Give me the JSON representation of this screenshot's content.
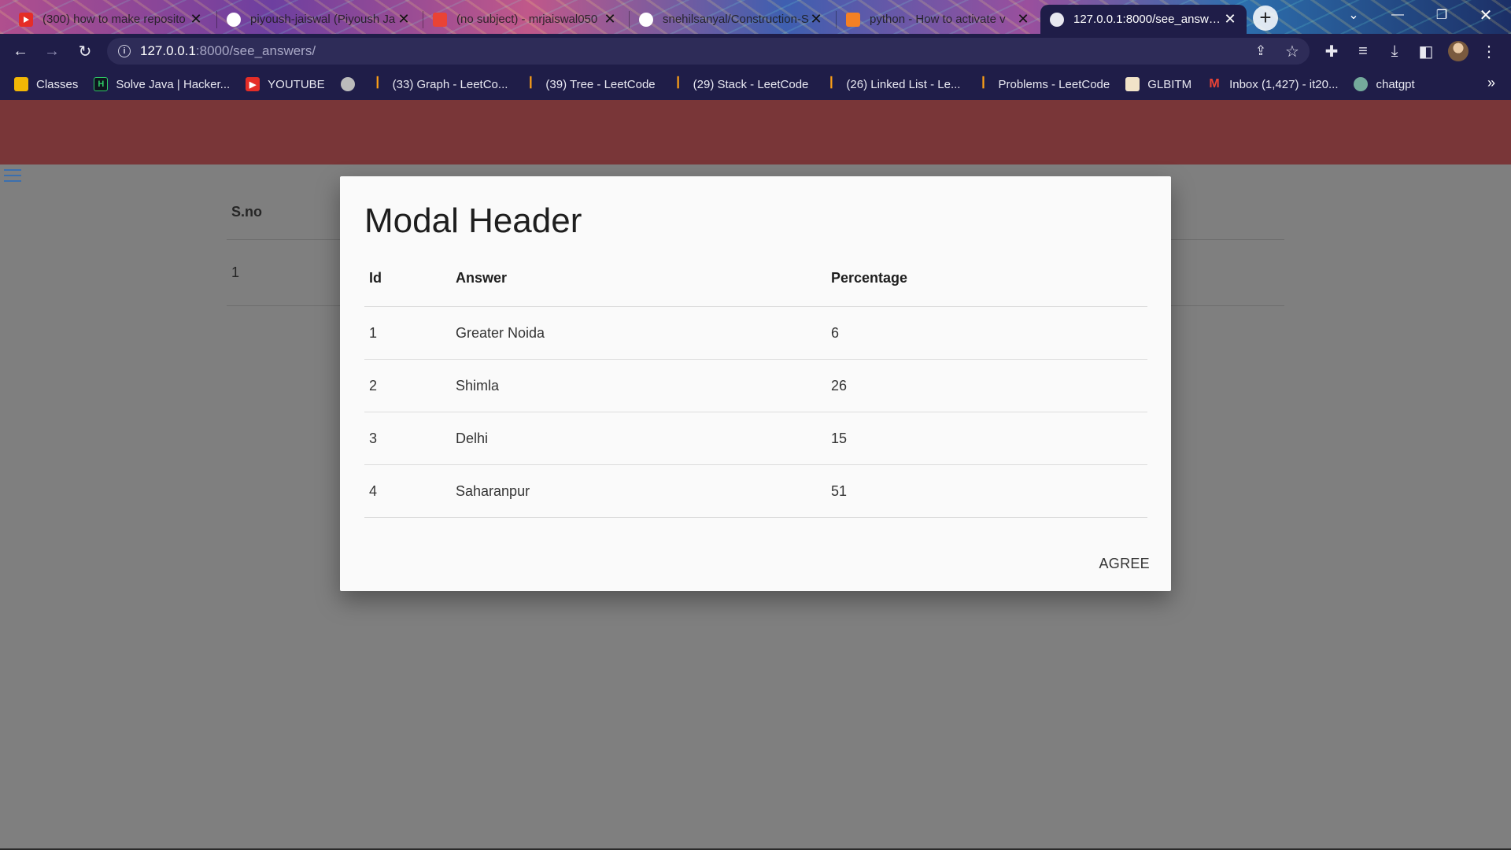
{
  "browser": {
    "tabs": [
      {
        "title": "(300) how to make reposito",
        "icon": "youtube-icon",
        "color": "#e52d27"
      },
      {
        "title": "piyoush-jaiswal (Piyoush Ja",
        "icon": "github-icon",
        "color": "#ffffff"
      },
      {
        "title": "(no subject) - mrjaiswal050",
        "icon": "gmail-icon",
        "color": "#ea4335"
      },
      {
        "title": "snehilsanyal/Construction-S",
        "icon": "github-icon",
        "color": "#ffffff"
      },
      {
        "title": "python - How to activate v",
        "icon": "stackoverflow-icon",
        "color": "#f48024"
      },
      {
        "title": "127.0.0.1:8000/see_answers",
        "icon": "globe-icon",
        "color": "#ffffff"
      }
    ],
    "url_host": "127.0.0.1",
    "url_path": ":8000/see_answers/",
    "bookmarks": [
      {
        "label": "Classes",
        "icon": "classroom-icon",
        "color": "#f2b705"
      },
      {
        "label": "Solve Java | Hacker...",
        "icon": "hackerrank-icon",
        "color": "#0e141e"
      },
      {
        "label": "YOUTUBE",
        "icon": "youtube-icon",
        "color": "#e52d27"
      },
      {
        "label": "",
        "icon": "globe-icon",
        "color": "#bbbbbb"
      },
      {
        "label": "(33) Graph - LeetCo...",
        "icon": "leetcode-icon",
        "color": "#ffa116"
      },
      {
        "label": "(39) Tree - LeetCode",
        "icon": "leetcode-icon",
        "color": "#ffa116"
      },
      {
        "label": "(29) Stack - LeetCode",
        "icon": "leetcode-icon",
        "color": "#ffa116"
      },
      {
        "label": "(26) Linked List - Le...",
        "icon": "leetcode-icon",
        "color": "#ffa116"
      },
      {
        "label": "Problems - LeetCode",
        "icon": "leetcode-icon",
        "color": "#ffa116"
      },
      {
        "label": "GLBITM",
        "icon": "glbitm-icon",
        "color": "#c0392b"
      },
      {
        "label": "Inbox (1,427) - it20...",
        "icon": "gmail-icon",
        "color": "#ea4335"
      },
      {
        "label": "chatgpt",
        "icon": "chatgpt-icon",
        "color": "#74aa9c"
      }
    ]
  },
  "background_table": {
    "header": "S.no",
    "rows": [
      "1"
    ]
  },
  "modal": {
    "title": "Modal Header",
    "columns": [
      "Id",
      "Answer",
      "Percentage"
    ],
    "rows": [
      [
        "1",
        "Greater Noida",
        "6"
      ],
      [
        "2",
        "Shimla",
        "26"
      ],
      [
        "3",
        "Delhi",
        "15"
      ],
      [
        "4",
        "Saharanpur",
        "51"
      ]
    ],
    "agree_label": "AGREE"
  },
  "colors": {
    "appbar": "#793638",
    "overlay": "#7f7f7f",
    "chrome_dark": "#1f1d48"
  }
}
